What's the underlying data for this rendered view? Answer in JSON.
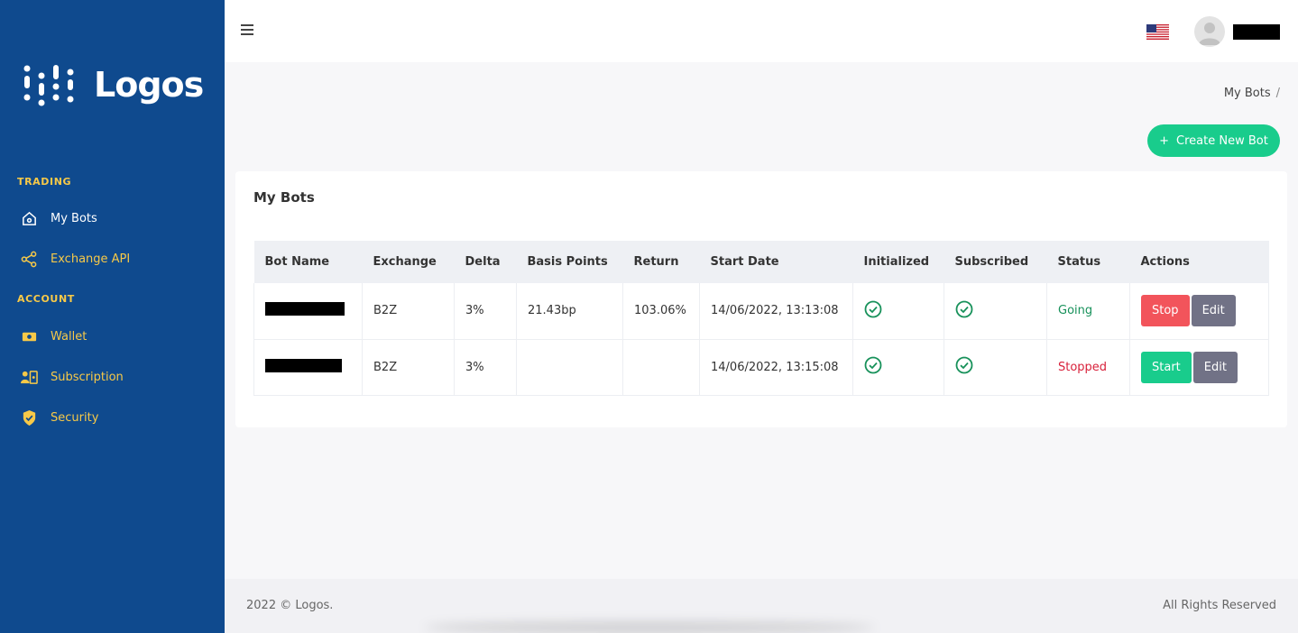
{
  "brand": {
    "name": "Logos"
  },
  "sidebar": {
    "sections": [
      {
        "label": "TRADING"
      },
      {
        "label": "ACCOUNT"
      }
    ],
    "items": [
      {
        "label": "My Bots",
        "icon": "home-icon"
      },
      {
        "label": "Exchange API",
        "icon": "share-icon"
      },
      {
        "label": "Wallet",
        "icon": "wallet-icon"
      },
      {
        "label": "Subscription",
        "icon": "subscription-icon"
      },
      {
        "label": "Security",
        "icon": "shield-icon"
      }
    ]
  },
  "header": {
    "menu_icon": "hamburger-icon",
    "flag": "us-flag-icon",
    "avatar": "avatar-icon"
  },
  "breadcrumb": {
    "current": "My Bots",
    "separator": "/"
  },
  "actions": {
    "create_label": "Create New Bot",
    "create_icon": "+"
  },
  "card": {
    "title": "My Bots",
    "columns": [
      "Bot Name",
      "Exchange",
      "Delta",
      "Basis Points",
      "Return",
      "Start Date",
      "Initialized",
      "Subscribed",
      "Status",
      "Actions"
    ],
    "rows": [
      {
        "exchange": "B2Z",
        "delta": "3%",
        "basis_points": "21.43bp",
        "return": "103.06%",
        "start_date": "14/06/2022, 13:13:08",
        "initialized": true,
        "subscribed": true,
        "status": "Going",
        "primary_action": "Stop",
        "secondary_action": "Edit"
      },
      {
        "exchange": "B2Z",
        "delta": "3%",
        "basis_points": "",
        "return": "",
        "start_date": "14/06/2022, 13:15:08",
        "initialized": true,
        "subscribed": true,
        "status": "Stopped",
        "primary_action": "Start",
        "secondary_action": "Edit"
      }
    ]
  },
  "footer": {
    "copyright": "2022 © Logos.",
    "rights": "All Rights Reserved"
  },
  "colors": {
    "sidebar": "#0f4a8e",
    "accent_yellow": "#f7c948",
    "success": "#19cc8c",
    "danger": "#f2545b",
    "edit": "#717286"
  }
}
